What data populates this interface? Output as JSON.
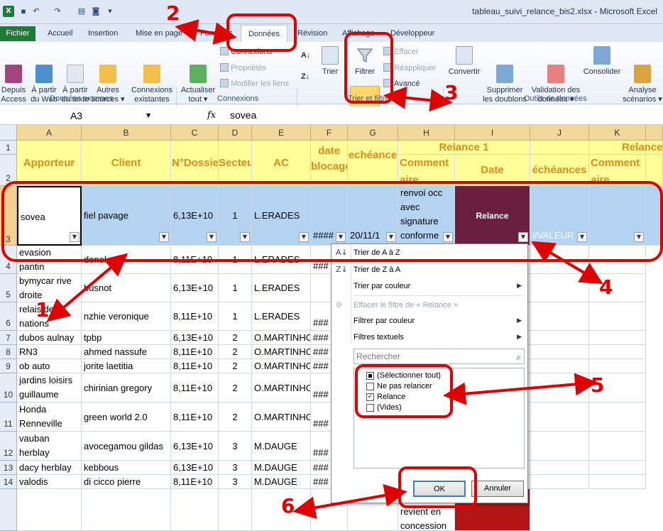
{
  "window": {
    "title": "tableau_suivi_relance_bis2.xlsx - Microsoft Excel"
  },
  "tabs": {
    "file": "Fichier",
    "items": [
      "Accueil",
      "Insertion",
      "Mise en page",
      "Formules",
      "Données",
      "Révision",
      "Affichage",
      "Développeur"
    ]
  },
  "ribbon": {
    "from_access": "Depuis\nAccess",
    "from_web": "À partir\ndu Web",
    "from_text": "À partir\ndu texte",
    "other_sources": "Autres\nsources ▾",
    "existing_connections": "Connexions\nexistantes",
    "group_external": "Données externes",
    "refresh_all": "Actualiser\ntout ▾",
    "connections": "Connexions",
    "properties": "Propriétés",
    "edit_links": "Modifier les liens",
    "group_connections": "Connexions",
    "sort": "Trier",
    "filter": "Filtrer",
    "clear": "Effacer",
    "reapply": "Réappliquer",
    "advanced": "Avancé",
    "group_sort_filter": "Trier et filtrer",
    "convert": "Convertir",
    "remove_duplicates": "Supprimer\nles doublons",
    "data_validation": "Validation des\ndonnées ▾",
    "consolidate": "Consolider",
    "what_if": "Analyse\nscénarios ▾",
    "group_data_tools": "Outils de données"
  },
  "formula_bar": {
    "name_box": "A3",
    "fx": "fx",
    "value": "sovea"
  },
  "columns": [
    "A",
    "B",
    "C",
    "D",
    "E",
    "F",
    "G",
    "H",
    "I",
    "J",
    "K"
  ],
  "header_row1": {
    "relance1": "Relance 1",
    "relance_next": "Relance"
  },
  "headers": {
    "A": "Apporteur",
    "B": "Client",
    "C": "N°Dossier",
    "D": "Secteur",
    "E": "AC",
    "F": "date\nblocage",
    "G": "echéance",
    "H": "Commentaire",
    "I": "Date",
    "J": "échéances",
    "K": "Commentaire"
  },
  "row_numbers": [
    "1",
    "2",
    "3",
    "4",
    "5",
    "6",
    "7",
    "8",
    "9",
    "10",
    "11",
    "12",
    "13",
    "14"
  ],
  "row3": {
    "A": "sovea",
    "B": "fiel pavage",
    "C": "6,13E+10",
    "D": "1",
    "E": "L.ERADES",
    "F": "####",
    "G": "20/11/1",
    "H": "renvoi occ\navec\nsignature\nconforme",
    "I": "Relance",
    "J": "#VALEUR"
  },
  "rows": [
    {
      "A": "evasion\npantin",
      "B": "donol",
      "C": "8,11E+10",
      "D": "1",
      "E": "L.ERADES",
      "F": "###"
    },
    {
      "A": "bymycar rive\ndroite",
      "B": "busnot",
      "C": "6,13E+10",
      "D": "1",
      "E": "L.ERADES",
      "F": ""
    },
    {
      "A": "relais des\nnations",
      "B": "nzhie veronique",
      "C": "8,11E+10",
      "D": "1",
      "E": "L.ERADES",
      "F": "###"
    },
    {
      "A": "dubos aulnay",
      "B": "tpbp",
      "C": "6,13E+10",
      "D": "2",
      "E": "O.MARTINHO",
      "F": "###"
    },
    {
      "A": "RN3",
      "B": "ahmed nassufe",
      "C": "8,11E+10",
      "D": "2",
      "E": "O.MARTINHO",
      "F": "###"
    },
    {
      "A": "ob auto",
      "B": "jorite laetitia",
      "C": "8,11E+10",
      "D": "2",
      "E": "O.MARTINHO",
      "F": "###"
    },
    {
      "A": "jardins loisirs\nguillaume",
      "B": "chirinian gregory",
      "C": "8,11E+10",
      "D": "2",
      "E": "O.MARTINHO",
      "F": "###"
    },
    {
      "A": "Honda\nRenneville",
      "B": "green world 2.0",
      "C": "8,11E+10",
      "D": "2",
      "E": "O.MARTINHO",
      "F": "###"
    },
    {
      "A": "vauban\nherblay",
      "B": "avocegamou gildas",
      "C": "6,13E+10",
      "D": "3",
      "E": "M.DAUGE",
      "F": "###"
    },
    {
      "A": "dacy herblay",
      "B": "kebbous",
      "C": "6,13E+10",
      "D": "3",
      "E": "M.DAUGE",
      "F": "###"
    },
    {
      "A": "valodis",
      "B": "di cicco pierre",
      "C": "8,11E+10",
      "D": "3",
      "E": "M.DAUGE",
      "F": "###"
    }
  ],
  "bottom_row": {
    "H": "revient en\nconcession"
  },
  "filter_menu": {
    "sort_az": "Trier de A à Z",
    "sort_za": "Trier de Z à A",
    "sort_color": "Trier par couleur",
    "clear_filter": "Effacer le filtre de « Relance »",
    "filter_color": "Filtrer par couleur",
    "text_filters": "Filtres textuels",
    "search_placeholder": "Rechercher",
    "options": [
      {
        "label": "(Sélectionner tout)",
        "state": "partial"
      },
      {
        "label": "Ne pas relancer",
        "state": "unchecked"
      },
      {
        "label": "Relance",
        "state": "checked"
      },
      {
        "label": "(Vides)",
        "state": "unchecked"
      }
    ],
    "ok": "OK",
    "cancel": "Annuler"
  },
  "annotations": [
    "1",
    "2",
    "3",
    "4",
    "5",
    "6"
  ],
  "colors": {
    "annotation": "#e00000",
    "header_fill": "#ffff99",
    "header_text": "#e38a1a",
    "selected_row": "#b4d3f0",
    "relance_fill": "#6b1f3f"
  }
}
